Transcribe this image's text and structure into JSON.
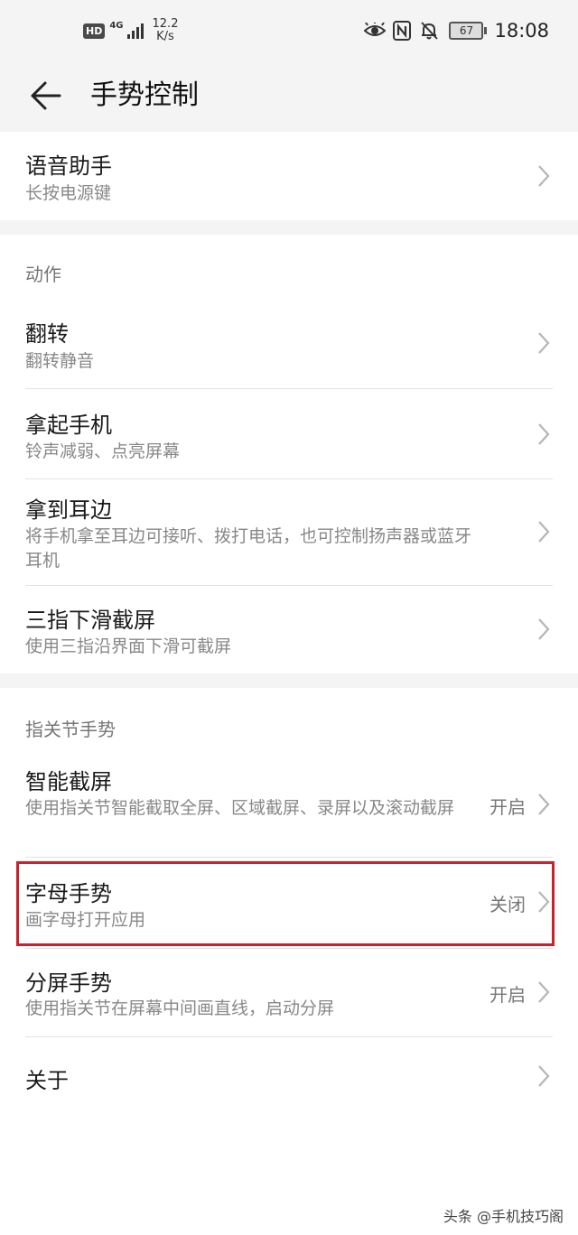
{
  "status_bar": {
    "hd": "HD",
    "network": "4G",
    "speed_value": "12.2",
    "speed_unit": "K/s",
    "icons": [
      "eye-comfort-icon",
      "nfc-icon",
      "bell-off-icon"
    ],
    "battery": "67",
    "time": "18:08"
  },
  "app_bar": {
    "back_icon": "arrow-left-icon",
    "title": "手势控制"
  },
  "groups": [
    {
      "header": "",
      "items": [
        {
          "title": "语音助手",
          "subtitle": "长按电源键",
          "value": ""
        }
      ]
    },
    {
      "header": "动作",
      "items": [
        {
          "title": "翻转",
          "subtitle": "翻转静音",
          "value": ""
        },
        {
          "title": "拿起手机",
          "subtitle": "铃声减弱、点亮屏幕",
          "value": ""
        },
        {
          "title": "拿到耳边",
          "subtitle": "将手机拿至耳边可接听、拨打电话，也可控制扬声器或蓝牙耳机",
          "value": ""
        },
        {
          "title": "三指下滑截屏",
          "subtitle": "使用三指沿界面下滑可截屏",
          "value": ""
        }
      ]
    },
    {
      "header": "指关节手势",
      "items": [
        {
          "title": "智能截屏",
          "subtitle": "使用指关节智能截取全屏、区域截屏、录屏以及滚动截屏",
          "value": "开启"
        },
        {
          "title": "字母手势",
          "subtitle": "画字母打开应用",
          "value": "关闭"
        },
        {
          "title": "分屏手势",
          "subtitle": "使用指关节在屏幕中间画直线，启动分屏",
          "value": "开启"
        },
        {
          "title": "关于",
          "subtitle": "",
          "value": ""
        }
      ]
    }
  ],
  "watermark": "头条 @手机技巧阁",
  "colors": {
    "highlight": "#c8232c",
    "background": "#f4f4f4"
  }
}
